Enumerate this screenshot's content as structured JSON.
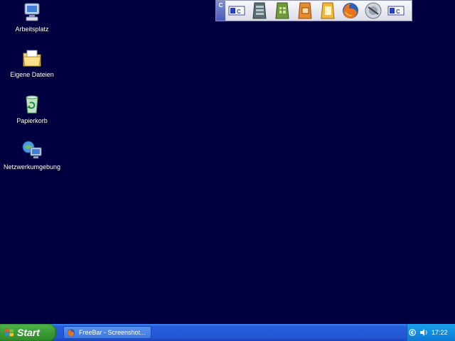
{
  "desktop": {
    "icons": [
      {
        "label": "Arbeitsplatz",
        "icon": "my-computer-icon"
      },
      {
        "label": "Eigene Dateien",
        "icon": "my-documents-icon"
      },
      {
        "label": "Papierkorb",
        "icon": "recycle-bin-icon"
      },
      {
        "label": "Netzwerkumgebung",
        "icon": "network-icon"
      }
    ],
    "background_color": "#000040"
  },
  "freebar": {
    "handle_label": "C",
    "icons": [
      "hypercam-icon",
      "presentation-icon",
      "spreadsheet-icon",
      "drawing-icon",
      "text-document-icon",
      "firefox-icon",
      "disc-icon",
      "hypercam-icon"
    ]
  },
  "taskbar": {
    "start_label": "Start",
    "task_label": "FreeBar - Screenshot...",
    "clock": "17:22"
  }
}
